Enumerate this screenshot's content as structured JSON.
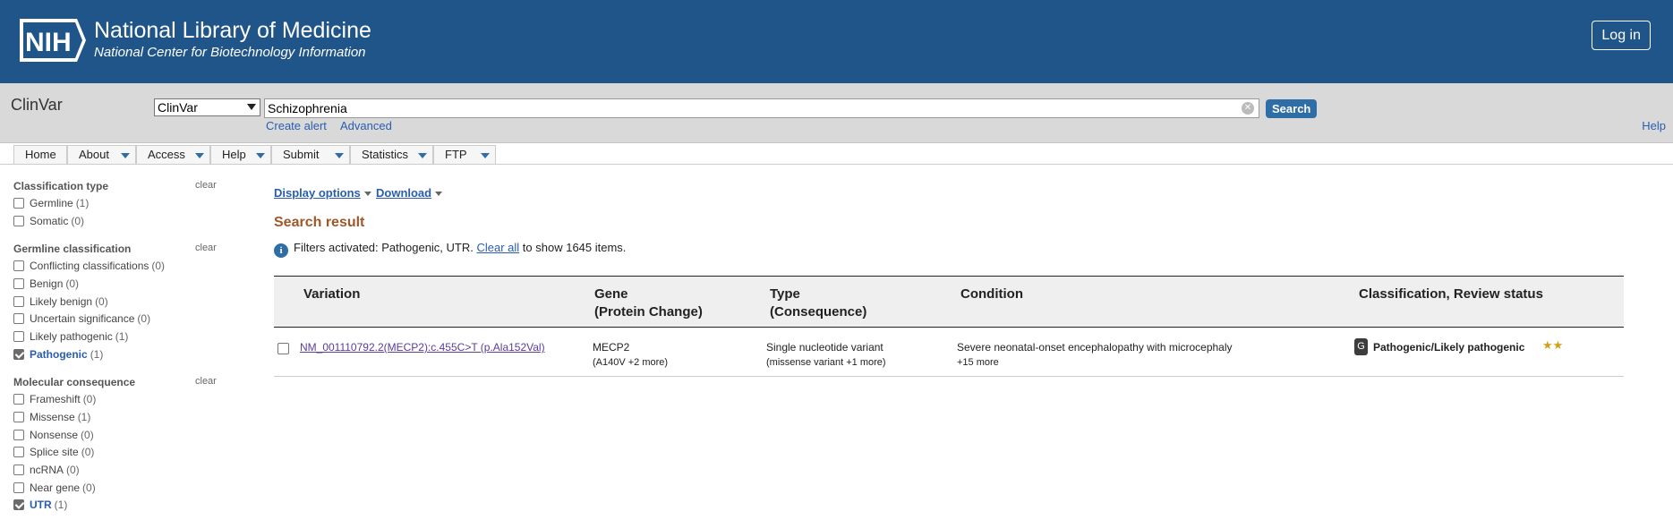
{
  "banner": {
    "logo_text": "NIH",
    "title": "National Library of Medicine",
    "subtitle": "National Center for Biotechnology Information",
    "login_label": "Log in"
  },
  "search": {
    "app_name": "ClinVar",
    "database": "ClinVar",
    "term": "Schizophrenia",
    "button_label": "Search",
    "create_alert": "Create alert",
    "advanced": "Advanced",
    "help": "Help"
  },
  "nav": {
    "items": [
      {
        "label": "Home"
      },
      {
        "label": "About"
      },
      {
        "label": "Access"
      },
      {
        "label": "Help"
      },
      {
        "label": "Submit"
      },
      {
        "label": "Statistics"
      },
      {
        "label": "FTP"
      }
    ]
  },
  "filters": {
    "clear_label": "clear",
    "groups": [
      {
        "heading": "Classification type",
        "items": [
          {
            "label": "Germline",
            "count": "(1)",
            "checked": false
          },
          {
            "label": "Somatic",
            "count": "(0)",
            "checked": false
          }
        ]
      },
      {
        "heading": "Germline classification",
        "items": [
          {
            "label": "Conflicting classifications",
            "count": "(0)",
            "checked": false
          },
          {
            "label": "Benign",
            "count": "(0)",
            "checked": false
          },
          {
            "label": "Likely benign",
            "count": "(0)",
            "checked": false
          },
          {
            "label": "Uncertain significance",
            "count": "(0)",
            "checked": false
          },
          {
            "label": "Likely pathogenic",
            "count": "(1)",
            "checked": false
          },
          {
            "label": "Pathogenic",
            "count": "(1)",
            "checked": true
          }
        ]
      },
      {
        "heading": "Molecular consequence",
        "items": [
          {
            "label": "Frameshift",
            "count": "(0)",
            "checked": false
          },
          {
            "label": "Missense",
            "count": "(1)",
            "checked": false
          },
          {
            "label": "Nonsense",
            "count": "(0)",
            "checked": false
          },
          {
            "label": "Splice site",
            "count": "(0)",
            "checked": false
          },
          {
            "label": "ncRNA",
            "count": "(0)",
            "checked": false
          },
          {
            "label": "Near gene",
            "count": "(0)",
            "checked": false
          },
          {
            "label": "UTR",
            "count": "(1)",
            "checked": true
          }
        ]
      }
    ]
  },
  "main": {
    "display_options": "Display options",
    "download": "Download",
    "result_title": "Search result",
    "filter_msg_prefix": "Filters activated: Pathogenic, UTR.",
    "clear_all": "Clear all",
    "filter_msg_suffix": "to show 1645 items."
  },
  "table": {
    "headers": {
      "variation": "Variation",
      "gene": "Gene",
      "gene_sub": "(Protein Change)",
      "type": "Type",
      "type_sub": "(Consequence)",
      "condition": "Condition",
      "classification": "Classification, Review status"
    },
    "rows": [
      {
        "variation": "NM_001110792.2(MECP2):c.455C>T (p.Ala152Val)",
        "gene": "MECP2",
        "protein_change": "(A140V +2 more)",
        "type": "Single nucleotide variant",
        "consequence": "(missense variant +1 more)",
        "condition": "Severe neonatal-onset encephalopathy with microcephaly",
        "condition_more": "+15 more",
        "badge": "G",
        "classification": "Pathogenic/Likely pathogenic",
        "stars": "★★"
      }
    ]
  },
  "colors": {
    "banner": "#20558a",
    "link": "#2a5db0",
    "result_title": "#a15727",
    "star": "#d1a01a"
  }
}
